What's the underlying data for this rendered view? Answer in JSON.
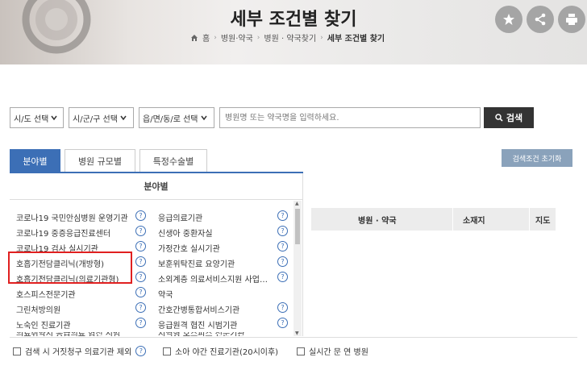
{
  "header": {
    "title": "세부 조건별 찾기",
    "breadcrumb": [
      "홈",
      "병원·약국",
      "병원 · 약국찾기",
      "세부 조건별 찾기"
    ]
  },
  "search": {
    "sido": "시/도 선택",
    "sigungu": "시/군/구 선택",
    "eupmyeon": "읍/면/동/로 선택",
    "placeholder": "병원명 또는 약국명을 입력하세요.",
    "button": "검색"
  },
  "tabs": [
    "분야별",
    "병원 규모별",
    "특정수술별"
  ],
  "reset_label": "검색조건 초기화",
  "section_title": "분야별",
  "left_items": [
    "코로나19 국민안심병원 운영기관",
    "코로나19 중증응급진료센터",
    "코로나19 검사 실시기관",
    "호흡기전담클리닉(개방형)",
    "호흡기전담클리닉(의료기관형)",
    "호스피스전문기관",
    "그린처방의원",
    "노숙인 진료기관",
    "의료취약지 응급의료 협진 시범"
  ],
  "right_items": [
    "응급의료기관",
    "신생아 중환자실",
    "가정간호 실시기관",
    "보훈위탁진료 요양기관",
    "소외계층 의료서비스지원 사업…",
    "약국",
    "간호간병통합서비스기관",
    "응급원격 협진 시범기관",
    "지역형 호스피스 전문기관"
  ],
  "table": {
    "col1": "병원 · 약국",
    "col2": "소재지",
    "col3": "지도"
  },
  "options": [
    "검색 시 거짓청구 의료기관 제외",
    "소아 야간 진료기관(20시이후)",
    "실시간 문 연 병원"
  ],
  "colors": {
    "accent": "#3c6fb6",
    "highlight": "#e02020"
  }
}
